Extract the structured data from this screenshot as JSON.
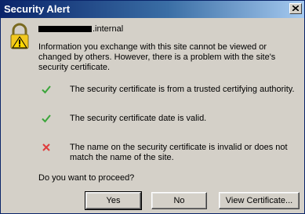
{
  "dialog": {
    "title": "Security Alert",
    "host": ".internal",
    "info": "Information you exchange with this site cannot be viewed or changed by others. However, there is a problem with the site's security certificate.",
    "checks": [
      {
        "status": "ok",
        "icon": "check-icon",
        "text": "The security certificate is from a trusted certifying authority."
      },
      {
        "status": "ok",
        "icon": "check-icon",
        "text": "The security certificate date is valid."
      },
      {
        "status": "error",
        "icon": "x-icon",
        "text": "The name on the security certificate is invalid or does not match the name of the site."
      }
    ],
    "question": "Do you want to proceed?",
    "buttons": {
      "yes": "Yes",
      "no": "No",
      "view": "View Certificate..."
    }
  },
  "colors": {
    "titlebar_start": "#0a246a",
    "titlebar_end": "#a6caf0",
    "check": "#3aa53a",
    "error": "#e03c3c",
    "face": "#d4d0c8"
  }
}
